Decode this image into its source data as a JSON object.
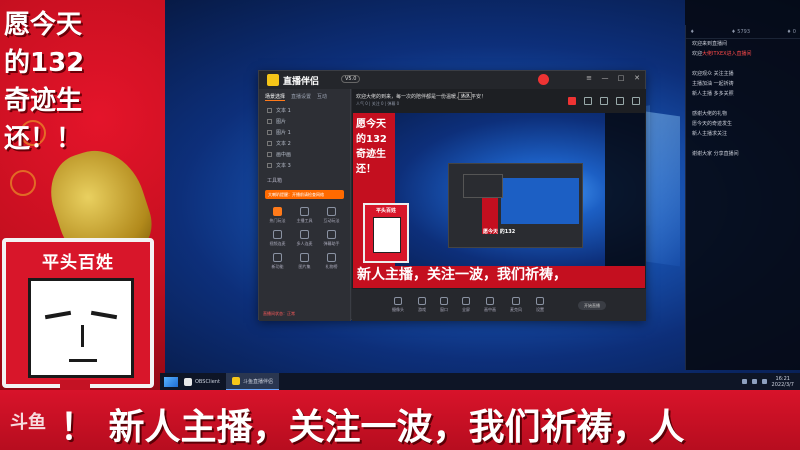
{
  "overlay": {
    "blessing_lines": [
      "愿今天",
      "的132",
      "奇迹生",
      "还！！"
    ],
    "sign_title": "平头百姓",
    "scroll_caption": "！  新人主播，关注一波，我们祈祷，人",
    "watermark": "斗鱼"
  },
  "app": {
    "title": "直播伴侣",
    "version": "V5.0",
    "tabs": [
      "场景选择",
      "直播设置",
      "互动"
    ],
    "scenes": [
      "文本 1",
      "图片",
      "图片 1",
      "文本 2",
      "画中画",
      "文本 3"
    ],
    "tool_label": "工具箱",
    "tools": [
      "热门玩法",
      "主播工具",
      "互动玩法",
      "视频连麦",
      "多人连麦",
      "弹幕助手",
      "新功能",
      "图片集",
      "礼物榜"
    ],
    "banner_text": "大喇叭提醒：开播前请检查网络",
    "info_line": "欢迎大佬的到来，每一次的陪伴都是一份温暖，人人平安！",
    "info_button": "修改",
    "stats_line": "人气 0  |  关注 0  |  弹幕 0",
    "preview_blessing": [
      "愿今天",
      "的132",
      "奇迹生",
      "还！"
    ],
    "preview_sign": "平头百姓",
    "preview_caption": "新人主播，关注一波，我们祈祷，",
    "preview_inner_caption": "愿今天 的132",
    "bottom_tools": [
      "摄像头",
      "游戏",
      "窗口",
      "全屏",
      "画中画",
      "麦克风",
      "设置"
    ],
    "go_live": "开始直播",
    "status_footer": "直播间状态：正常"
  },
  "chat": {
    "header_left": "♦",
    "header_mid": "♦ 5793",
    "header_right": "♦ 0",
    "messages": [
      {
        "text": "欢迎来到直播间",
        "hl": ""
      },
      {
        "text": "欢迎",
        "hl": "大佬ITXEX进入直播间"
      },
      {
        "text": "",
        "hl": ""
      },
      {
        "text": "欢迎观众 关注主播",
        "hl": ""
      },
      {
        "text": "主播加油 一起祈祷",
        "hl": ""
      },
      {
        "text": "新人主播 多多关照",
        "hl": ""
      },
      {
        "text": "",
        "hl": ""
      },
      {
        "text": "感谢大佬的礼物",
        "hl": ""
      },
      {
        "text": "愿今天的奇迹发生",
        "hl": ""
      },
      {
        "text": "新人主播求关注",
        "hl": ""
      },
      {
        "text": "",
        "hl": ""
      },
      {
        "text": "谢谢大家 分享直播间",
        "hl": ""
      }
    ]
  },
  "taskbar": {
    "items": [
      "OBSClient",
      "斗鱼直播伴侣"
    ],
    "time": "16:21",
    "date": "2022/3/7"
  }
}
